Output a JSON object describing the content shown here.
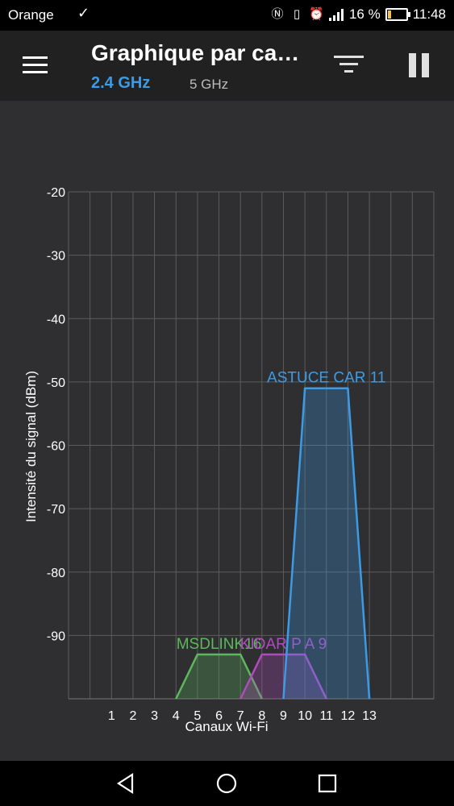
{
  "status_bar": {
    "carrier": "Orange",
    "battery_percent": "16 %",
    "time": "11:48",
    "icons": [
      "check-icon",
      "nfc-icon",
      "vibrate-icon",
      "alarm-icon",
      "signal-icon",
      "battery-icon"
    ]
  },
  "app_bar": {
    "title": "Graphique par ca…",
    "tabs": [
      {
        "label": "2.4 GHz",
        "active": true,
        "color": "#3d9be6"
      },
      {
        "label": "5 GHz",
        "active": false
      }
    ],
    "icons": [
      "menu-icon",
      "filter-icon",
      "pause-icon"
    ]
  },
  "nav_bar": {
    "icons": [
      "back-icon",
      "home-icon",
      "recents-icon"
    ]
  },
  "chart_data": {
    "type": "area",
    "title": "",
    "xlabel": "Canaux Wi-Fi",
    "ylabel": "Intensité du signal (dBm)",
    "ylim": [
      -100,
      -20
    ],
    "xlim": [
      -1,
      16
    ],
    "x_ticks": [
      1,
      2,
      3,
      4,
      5,
      6,
      7,
      8,
      9,
      10,
      11,
      12,
      13
    ],
    "y_ticks": [
      -20,
      -30,
      -40,
      -50,
      -60,
      -70,
      -80,
      -90
    ],
    "grid": true,
    "series": [
      {
        "name": "MSDLINK16",
        "channel": 6,
        "signal_dbm": -93,
        "color": "#5cb85c",
        "points": [
          [
            4,
            -100
          ],
          [
            5,
            -93
          ],
          [
            7,
            -93
          ],
          [
            8,
            -100
          ]
        ]
      },
      {
        "name": "KIDAR P A 9",
        "channel": 9,
        "signal_dbm": -93,
        "color": "#b04ac0",
        "points": [
          [
            7,
            -100
          ],
          [
            8,
            -93
          ],
          [
            10,
            -93
          ],
          [
            11,
            -100
          ]
        ]
      },
      {
        "name": "ASTUCE CAR 11",
        "channel": 11,
        "signal_dbm": -51,
        "color": "#3d9be6",
        "points": [
          [
            9,
            -100
          ],
          [
            10,
            -51
          ],
          [
            12,
            -51
          ],
          [
            13,
            -100
          ]
        ]
      }
    ]
  }
}
